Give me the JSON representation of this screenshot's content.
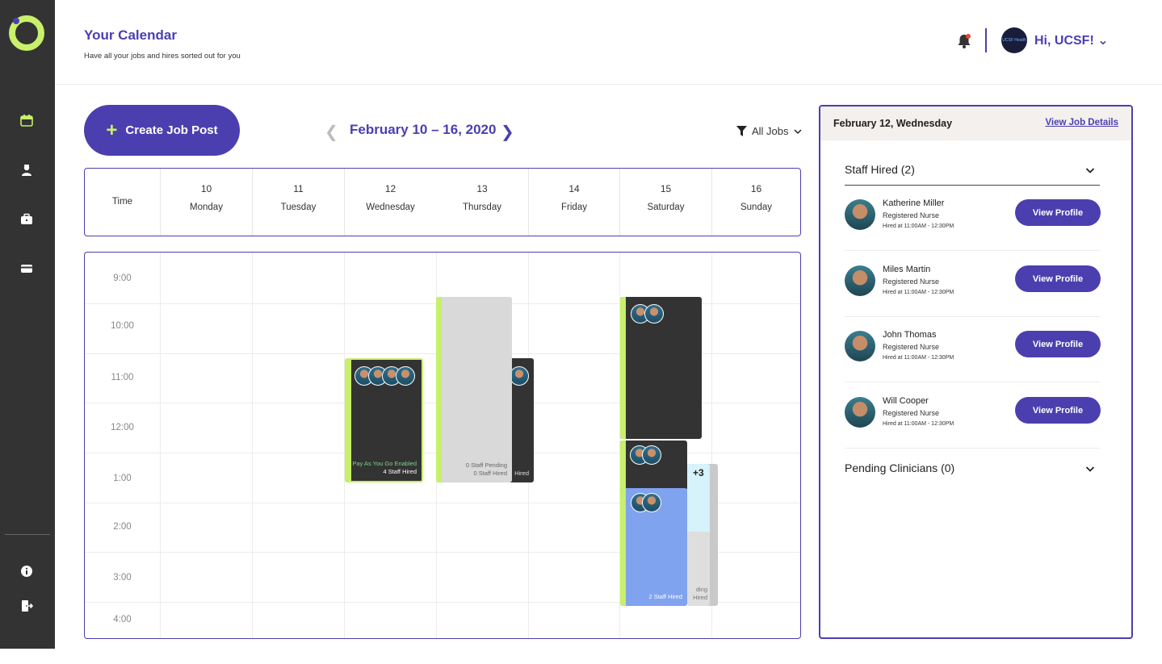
{
  "header": {
    "title": "Your Calendar",
    "subtitle": "Have all your jobs and hires sorted out for you",
    "greeting": "Hi, UCSF! ⌄",
    "avatar_text": "UCSF Health"
  },
  "sidebar": {
    "items": [
      {
        "name": "calendar-icon",
        "active": true
      },
      {
        "name": "staff-icon"
      },
      {
        "name": "briefcase-icon"
      },
      {
        "name": "credit-card-icon"
      },
      {
        "name": "info-icon"
      },
      {
        "name": "logout-icon"
      }
    ]
  },
  "toolbar": {
    "create_label": "Create Job Post",
    "week_range": "February 10 – 16, 2020",
    "filter_label": "All Jobs"
  },
  "calendar": {
    "time_header": "Time",
    "days": [
      {
        "num": "10",
        "name": "Monday"
      },
      {
        "num": "11",
        "name": "Tuesday"
      },
      {
        "num": "12",
        "name": "Wednesday"
      },
      {
        "num": "13",
        "name": "Thursday"
      },
      {
        "num": "14",
        "name": "Friday"
      },
      {
        "num": "15",
        "name": "Saturday"
      },
      {
        "num": "16",
        "name": "Sunday"
      }
    ],
    "times": [
      "9:00",
      "10:00",
      "11:00",
      "12:00",
      "1:00",
      "2:00",
      "3:00",
      "4:00"
    ],
    "events": {
      "wed_line1": "Pay As You Go Enabled",
      "wed_line2": "4 Staff Hired",
      "thu_pending": "0 Staff Pending",
      "thu_hired": "0 Staff Hired",
      "thu_overlap_hired": "Hired",
      "sat_hired": "2 Staff Hired",
      "sat_more": "+3",
      "sat_pending_partial": "ding",
      "sat_hired_partial": "Hired"
    }
  },
  "panel": {
    "date": "February 12, Wednesday",
    "link": "View Job Details",
    "staff_section": "Staff Hired (2)",
    "pending_section": "Pending Clinicians (0)",
    "button_label": "View Profile",
    "staff": [
      {
        "name": "Katherine Miller",
        "role": "Registered Nurse",
        "time": "Hired at 11:00AM - 12:30PM"
      },
      {
        "name": "Miles Martin",
        "role": "Registered Nurse",
        "time": "Hired at 11:00AM - 12:30PM"
      },
      {
        "name": "John Thomas",
        "role": "Registered Nurse",
        "time": "Hired at 11:00AM - 12:30PM"
      },
      {
        "name": "Will Cooper",
        "role": "Registered Nurse",
        "time": "Hired at 11:00AM - 12:30PM"
      }
    ]
  },
  "colors": {
    "brand": "#4b3fb0",
    "accent": "#c8f06a",
    "sidebar": "#333333"
  }
}
